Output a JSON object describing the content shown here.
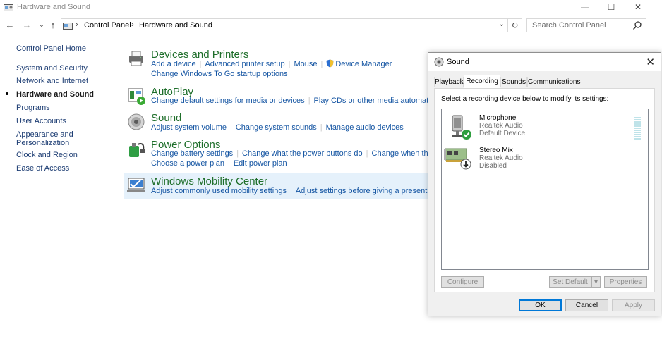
{
  "window": {
    "title": "Hardware and Sound",
    "minimize": "—",
    "maximize": "☐",
    "close": "✕"
  },
  "nav": {
    "back": "←",
    "forward": "→",
    "recent": "⌄",
    "up": "↑",
    "breadcrumbs": [
      "Control Panel",
      "Hardware and Sound"
    ],
    "refresh": "↻",
    "search_placeholder": "Search Control Panel"
  },
  "sidebar": {
    "items": [
      {
        "label": "Control Panel Home"
      },
      {
        "label": "System and Security"
      },
      {
        "label": "Network and Internet"
      },
      {
        "label": "Hardware and Sound"
      },
      {
        "label": "Programs"
      },
      {
        "label": "User Accounts"
      },
      {
        "label": "Appearance and"
      },
      {
        "label": "Personalization"
      },
      {
        "label": "Clock and Region"
      },
      {
        "label": "Ease of Access"
      }
    ]
  },
  "categories": [
    {
      "heading": "Devices and Printers",
      "icon": "printer-icon",
      "line1": [
        "Add a device",
        "Advanced printer setup",
        "Mouse",
        "Device Manager"
      ],
      "line2": [
        "Change Windows To Go startup options"
      ]
    },
    {
      "heading": "AutoPlay",
      "icon": "autoplay-icon",
      "line1": [
        "Change default settings for media or devices",
        "Play CDs or other media automatically"
      ]
    },
    {
      "heading": "Sound",
      "icon": "speaker-icon",
      "line1": [
        "Adjust system volume",
        "Change system sounds",
        "Manage audio devices"
      ]
    },
    {
      "heading": "Power Options",
      "icon": "power-icon",
      "line1": [
        "Change battery settings",
        "Change what the power buttons do",
        "Change when the com"
      ],
      "line2": [
        "Choose a power plan",
        "Edit power plan"
      ]
    },
    {
      "heading": "Windows Mobility Center",
      "icon": "mobility-center-icon",
      "line1": [
        "Adjust commonly used mobility settings",
        "Adjust settings before giving a presentation"
      ]
    }
  ],
  "dialog": {
    "title": "Sound",
    "close": "✕",
    "tabs": [
      "Playback",
      "Recording",
      "Sounds",
      "Communications"
    ],
    "active_tab": "Recording",
    "instruction": "Select a recording device below to modify its settings:",
    "devices": [
      {
        "name": "Microphone",
        "driver": "Realtek Audio",
        "status": "Default Device",
        "icon": "microphone-icon",
        "badge": "checkmark-badge-icon"
      },
      {
        "name": "Stereo Mix",
        "driver": "Realtek Audio",
        "status": "Disabled",
        "icon": "sound-card-icon",
        "badge": "disabled-arrow-badge-icon"
      }
    ],
    "configure": "Configure",
    "set_default": "Set Default",
    "properties": "Properties",
    "ok": "OK",
    "cancel": "Cancel",
    "apply": "Apply"
  },
  "colors": {
    "heading_green": "#1e6e2a",
    "link_blue": "#1656a3",
    "nav_blue": "#1d3d73",
    "accent": "#0078d7",
    "hover_bg": "#e5f1fb"
  }
}
